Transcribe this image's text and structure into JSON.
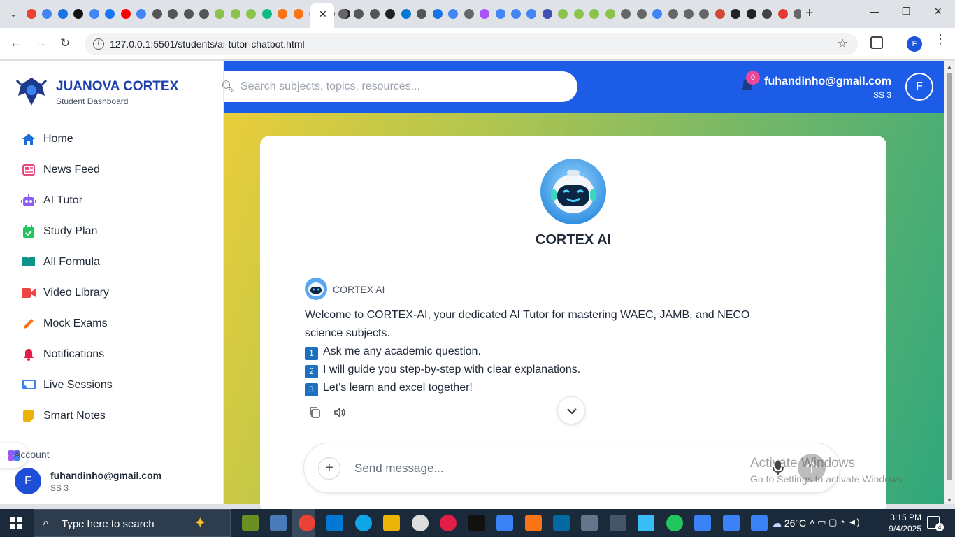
{
  "browser": {
    "url": "127.0.0.1:5501/students/ai-tutor-chatbot.html",
    "active_tab_close": "✕",
    "new_tab": "+"
  },
  "sidebar": {
    "brand_name": "JUANOVA CORTEX",
    "brand_sub": "Student Dashboard",
    "items": [
      {
        "label": "Home",
        "icon": "home-icon",
        "color": "#1d6fd6"
      },
      {
        "label": "News Feed",
        "icon": "newspaper-icon",
        "color": "#e64980"
      },
      {
        "label": "AI Tutor",
        "icon": "robot-icon",
        "color": "#8b5cf6"
      },
      {
        "label": "Study Plan",
        "icon": "calendar-check-icon",
        "color": "#22c55e"
      },
      {
        "label": "All Formula",
        "icon": "book-open-icon",
        "color": "#0d9488"
      },
      {
        "label": "Video Library",
        "icon": "video-icon",
        "color": "#ef4444"
      },
      {
        "label": "Mock Exams",
        "icon": "pencil-icon",
        "color": "#f97316"
      },
      {
        "label": "Notifications",
        "icon": "bell-icon",
        "color": "#e11d48"
      },
      {
        "label": "Live Sessions",
        "icon": "chalkboard-icon",
        "color": "#3b82f6"
      },
      {
        "label": "Smart Notes",
        "icon": "sticky-note-icon",
        "color": "#eab308"
      }
    ],
    "account_title": "Account",
    "account_initial": "F",
    "account_email": "fuhandinho@gmail.com",
    "account_class": "SS 3"
  },
  "header": {
    "search_placeholder": "Search subjects, topics, resources...",
    "notification_count": "0",
    "user_email": "fuhandinho@gmail.com",
    "user_class": "SS 3",
    "user_initial": "F"
  },
  "chat": {
    "bot_title": "CORTEX AI",
    "sender": "CORTEX AI",
    "welcome_line": "Welcome to CORTEX-AI, your dedicated AI Tutor for mastering WAEC, JAMB, and NECO science subjects.",
    "steps": [
      {
        "num": "1",
        "text": "Ask me any academic question."
      },
      {
        "num": "2",
        "text": "I will guide you step-by-step with clear explanations."
      },
      {
        "num": "3",
        "text": "Let's learn and excel together!"
      }
    ],
    "composer_placeholder": "Send message..."
  },
  "watermark": {
    "line1": "Activate Windows",
    "line2": "Go to Settings to activate Windows."
  },
  "taskbar": {
    "search_text": "Type here to search",
    "weather": "26°C",
    "time": "3:15 PM",
    "date": "9/4/2025",
    "notification_count": "4"
  },
  "colors": {
    "brand_blue": "#1d5ce6",
    "brand_dark_blue": "#1e40af"
  }
}
